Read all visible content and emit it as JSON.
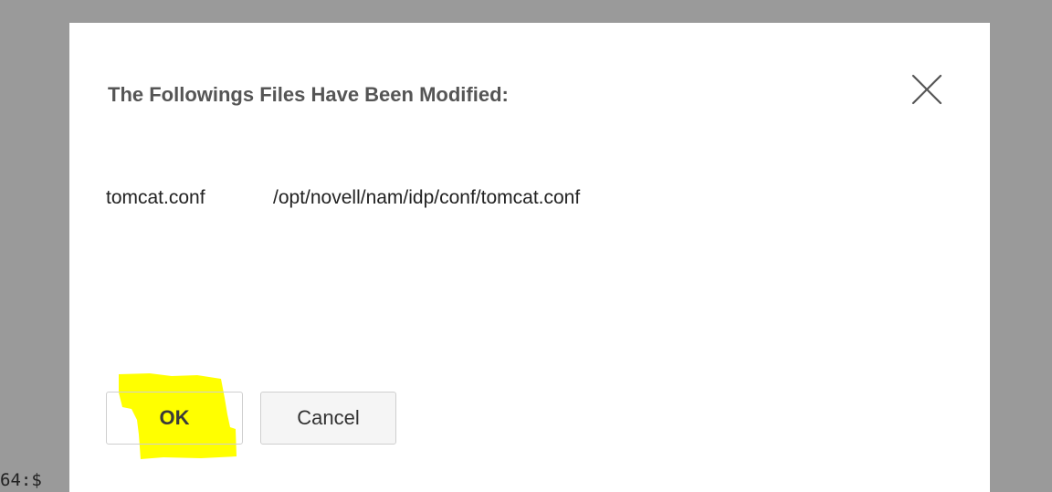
{
  "background_terminal": {
    "visible_text": "64:$"
  },
  "dialog": {
    "title": "The Followings Files Have Been Modified:",
    "close_icon": "close-x-icon",
    "files": [
      {
        "name": "tomcat.conf",
        "path": "/opt/novell/nam/idp/conf/tomcat.conf"
      }
    ],
    "buttons": {
      "ok_label": "OK",
      "cancel_label": "Cancel"
    }
  },
  "colors": {
    "overlay": "#9a9a9a",
    "dialog_background": "#ffffff",
    "title_text": "#555555",
    "highlight": "#ffff00"
  }
}
